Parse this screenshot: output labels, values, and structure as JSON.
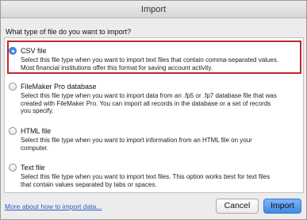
{
  "window": {
    "title": "Import"
  },
  "prompt": "What type of file do you want to import?",
  "options": [
    {
      "label": "CSV file",
      "description": "Select this file type when you want to import text files that contain comma-separated values.\nMost financial institutions offer this format for saving account activity.",
      "selected": true
    },
    {
      "label": "FileMaker Pro database",
      "description": "Select this file type when you want to import data from an .fp5 or .fp7 database file that was\ncreated with FileMaker Pro.  You can import all records in the database or a set of records\nyou specify.",
      "selected": false
    },
    {
      "label": "HTML file",
      "description": "Select this file type when you want to import information from an HTML file on your\ncomputer.",
      "selected": false
    },
    {
      "label": "Text file",
      "description": "Select this file type when you want to import text files.  This option works best for text files\nthat contain values separated by tabs or spaces.",
      "selected": false
    }
  ],
  "footer": {
    "help_link": "More about how to import data...",
    "cancel_label": "Cancel",
    "import_label": "Import"
  },
  "colors": {
    "highlight_border": "#c0272d",
    "accent": "#4a8be6",
    "link": "#2a5cc7"
  }
}
